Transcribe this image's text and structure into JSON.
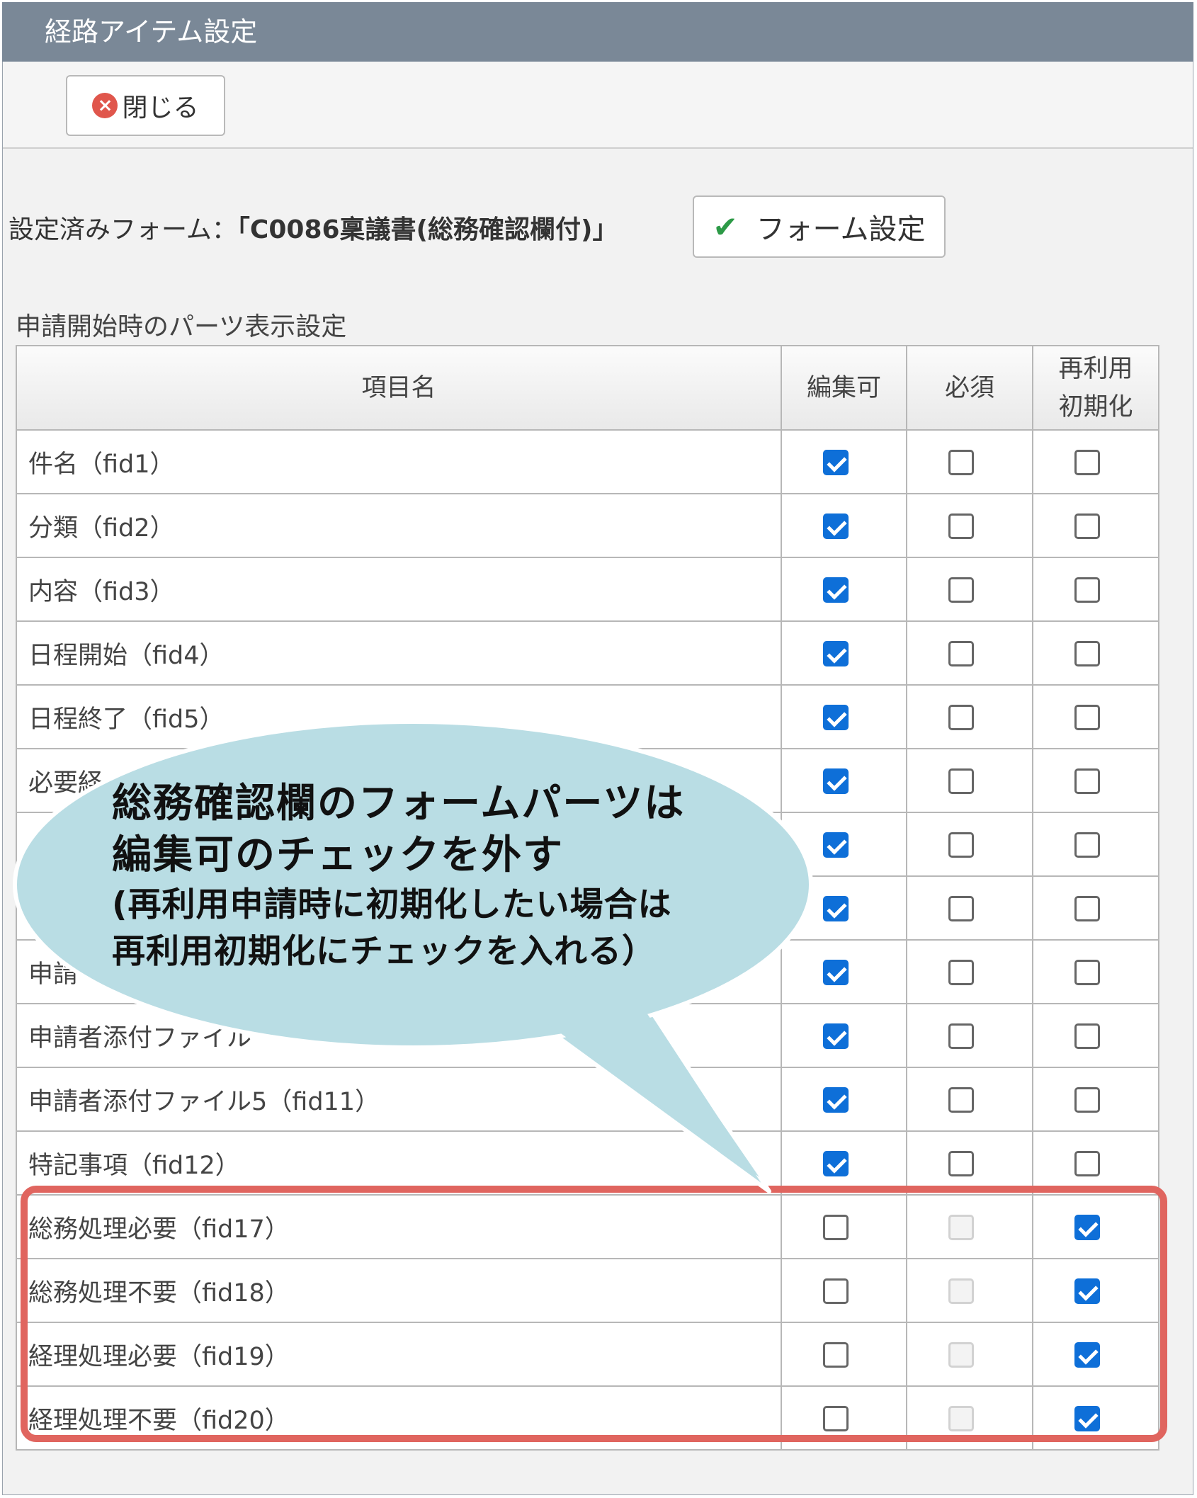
{
  "window": {
    "title": "経路アイテム設定"
  },
  "toolbar": {
    "close_label": "閉じる"
  },
  "form": {
    "label": "設定済みフォーム：",
    "name": "「C0086稟議書(総務確認欄付)」",
    "settings_button_label": "フォーム設定"
  },
  "section": {
    "title": "申請開始時のパーツ表示設定"
  },
  "table": {
    "headers": {
      "name": "項目名",
      "editable": "編集可",
      "required": "必須",
      "reset_line1": "再利用",
      "reset_line2": "初期化"
    },
    "rows": [
      {
        "name": "件名（fid1）",
        "editable": true,
        "required": false,
        "reset": false
      },
      {
        "name": "分類（fid2）",
        "editable": true,
        "required": false,
        "reset": false
      },
      {
        "name": "内容（fid3）",
        "editable": true,
        "required": false,
        "reset": false
      },
      {
        "name": "日程開始（fid4）",
        "editable": true,
        "required": false,
        "reset": false
      },
      {
        "name": "日程終了（fid5）",
        "editable": true,
        "required": false,
        "reset": false
      },
      {
        "name": "必要経",
        "editable": true,
        "required": false,
        "reset": false
      },
      {
        "name": "",
        "editable": true,
        "required": false,
        "reset": false
      },
      {
        "name": "",
        "editable": true,
        "required": false,
        "reset": false
      },
      {
        "name": "申請",
        "editable": true,
        "required": false,
        "reset": false
      },
      {
        "name": "申請者添付ファイル",
        "editable": true,
        "required": false,
        "reset": false
      },
      {
        "name": "申請者添付ファイル5（fid11）",
        "editable": true,
        "required": false,
        "reset": false
      },
      {
        "name": "特記事項（fid12）",
        "editable": true,
        "required": false,
        "reset": false
      },
      {
        "name": "総務処理必要（fid17）",
        "editable": false,
        "required": "disabled",
        "reset": true
      },
      {
        "name": "総務処理不要（fid18）",
        "editable": false,
        "required": "disabled",
        "reset": true
      },
      {
        "name": "経理処理必要（fid19）",
        "editable": false,
        "required": "disabled",
        "reset": true
      },
      {
        "name": "経理処理不要（fid20）",
        "editable": false,
        "required": "disabled",
        "reset": true
      }
    ]
  },
  "callout": {
    "line1": "総務確認欄のフォームパーツは",
    "line2": "編集可のチェックを外す",
    "line3": "(再利用申請時に初期化したい場合は",
    "line4": "再利用初期化にチェックを入れる）"
  },
  "colors": {
    "titlebar": "#7a8897",
    "checkbox_checked": "#0e6fd8",
    "highlight_border": "#e0655f",
    "callout_fill": "#b9dde4"
  }
}
